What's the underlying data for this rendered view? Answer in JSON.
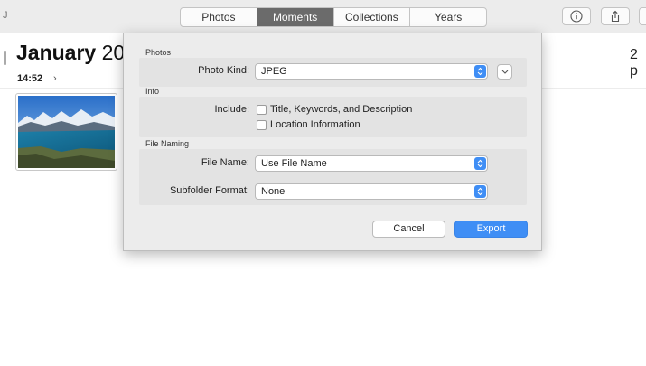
{
  "toolbar": {
    "left_glyph": "J",
    "tabs": [
      {
        "label": "Photos",
        "active": false
      },
      {
        "label": "Moments",
        "active": true
      },
      {
        "label": "Collections",
        "active": false
      },
      {
        "label": "Years",
        "active": false
      }
    ],
    "buttons": [
      "info-icon",
      "share-icon"
    ]
  },
  "content": {
    "month_title": "January",
    "month_year_partial": "20",
    "count_partial": "2 p",
    "time": "14:52",
    "time_chevron": "›"
  },
  "dialog": {
    "photos_section": "Photos",
    "photo_kind_label": "Photo Kind:",
    "photo_kind_value": "JPEG",
    "info_section": "Info",
    "include_label": "Include:",
    "checkboxes": [
      {
        "label": "Title, Keywords, and Description",
        "checked": false
      },
      {
        "label": "Location Information",
        "checked": false
      }
    ],
    "file_naming_section": "File Naming",
    "file_name_label": "File Name:",
    "file_name_value": "Use File Name",
    "subfolder_label": "Subfolder Format:",
    "subfolder_value": "None",
    "cancel_label": "Cancel",
    "export_label": "Export"
  },
  "colors": {
    "accent": "#3f8ef5",
    "toolbar_bg": "#ececec",
    "active_tab": "#6b6b6b"
  }
}
